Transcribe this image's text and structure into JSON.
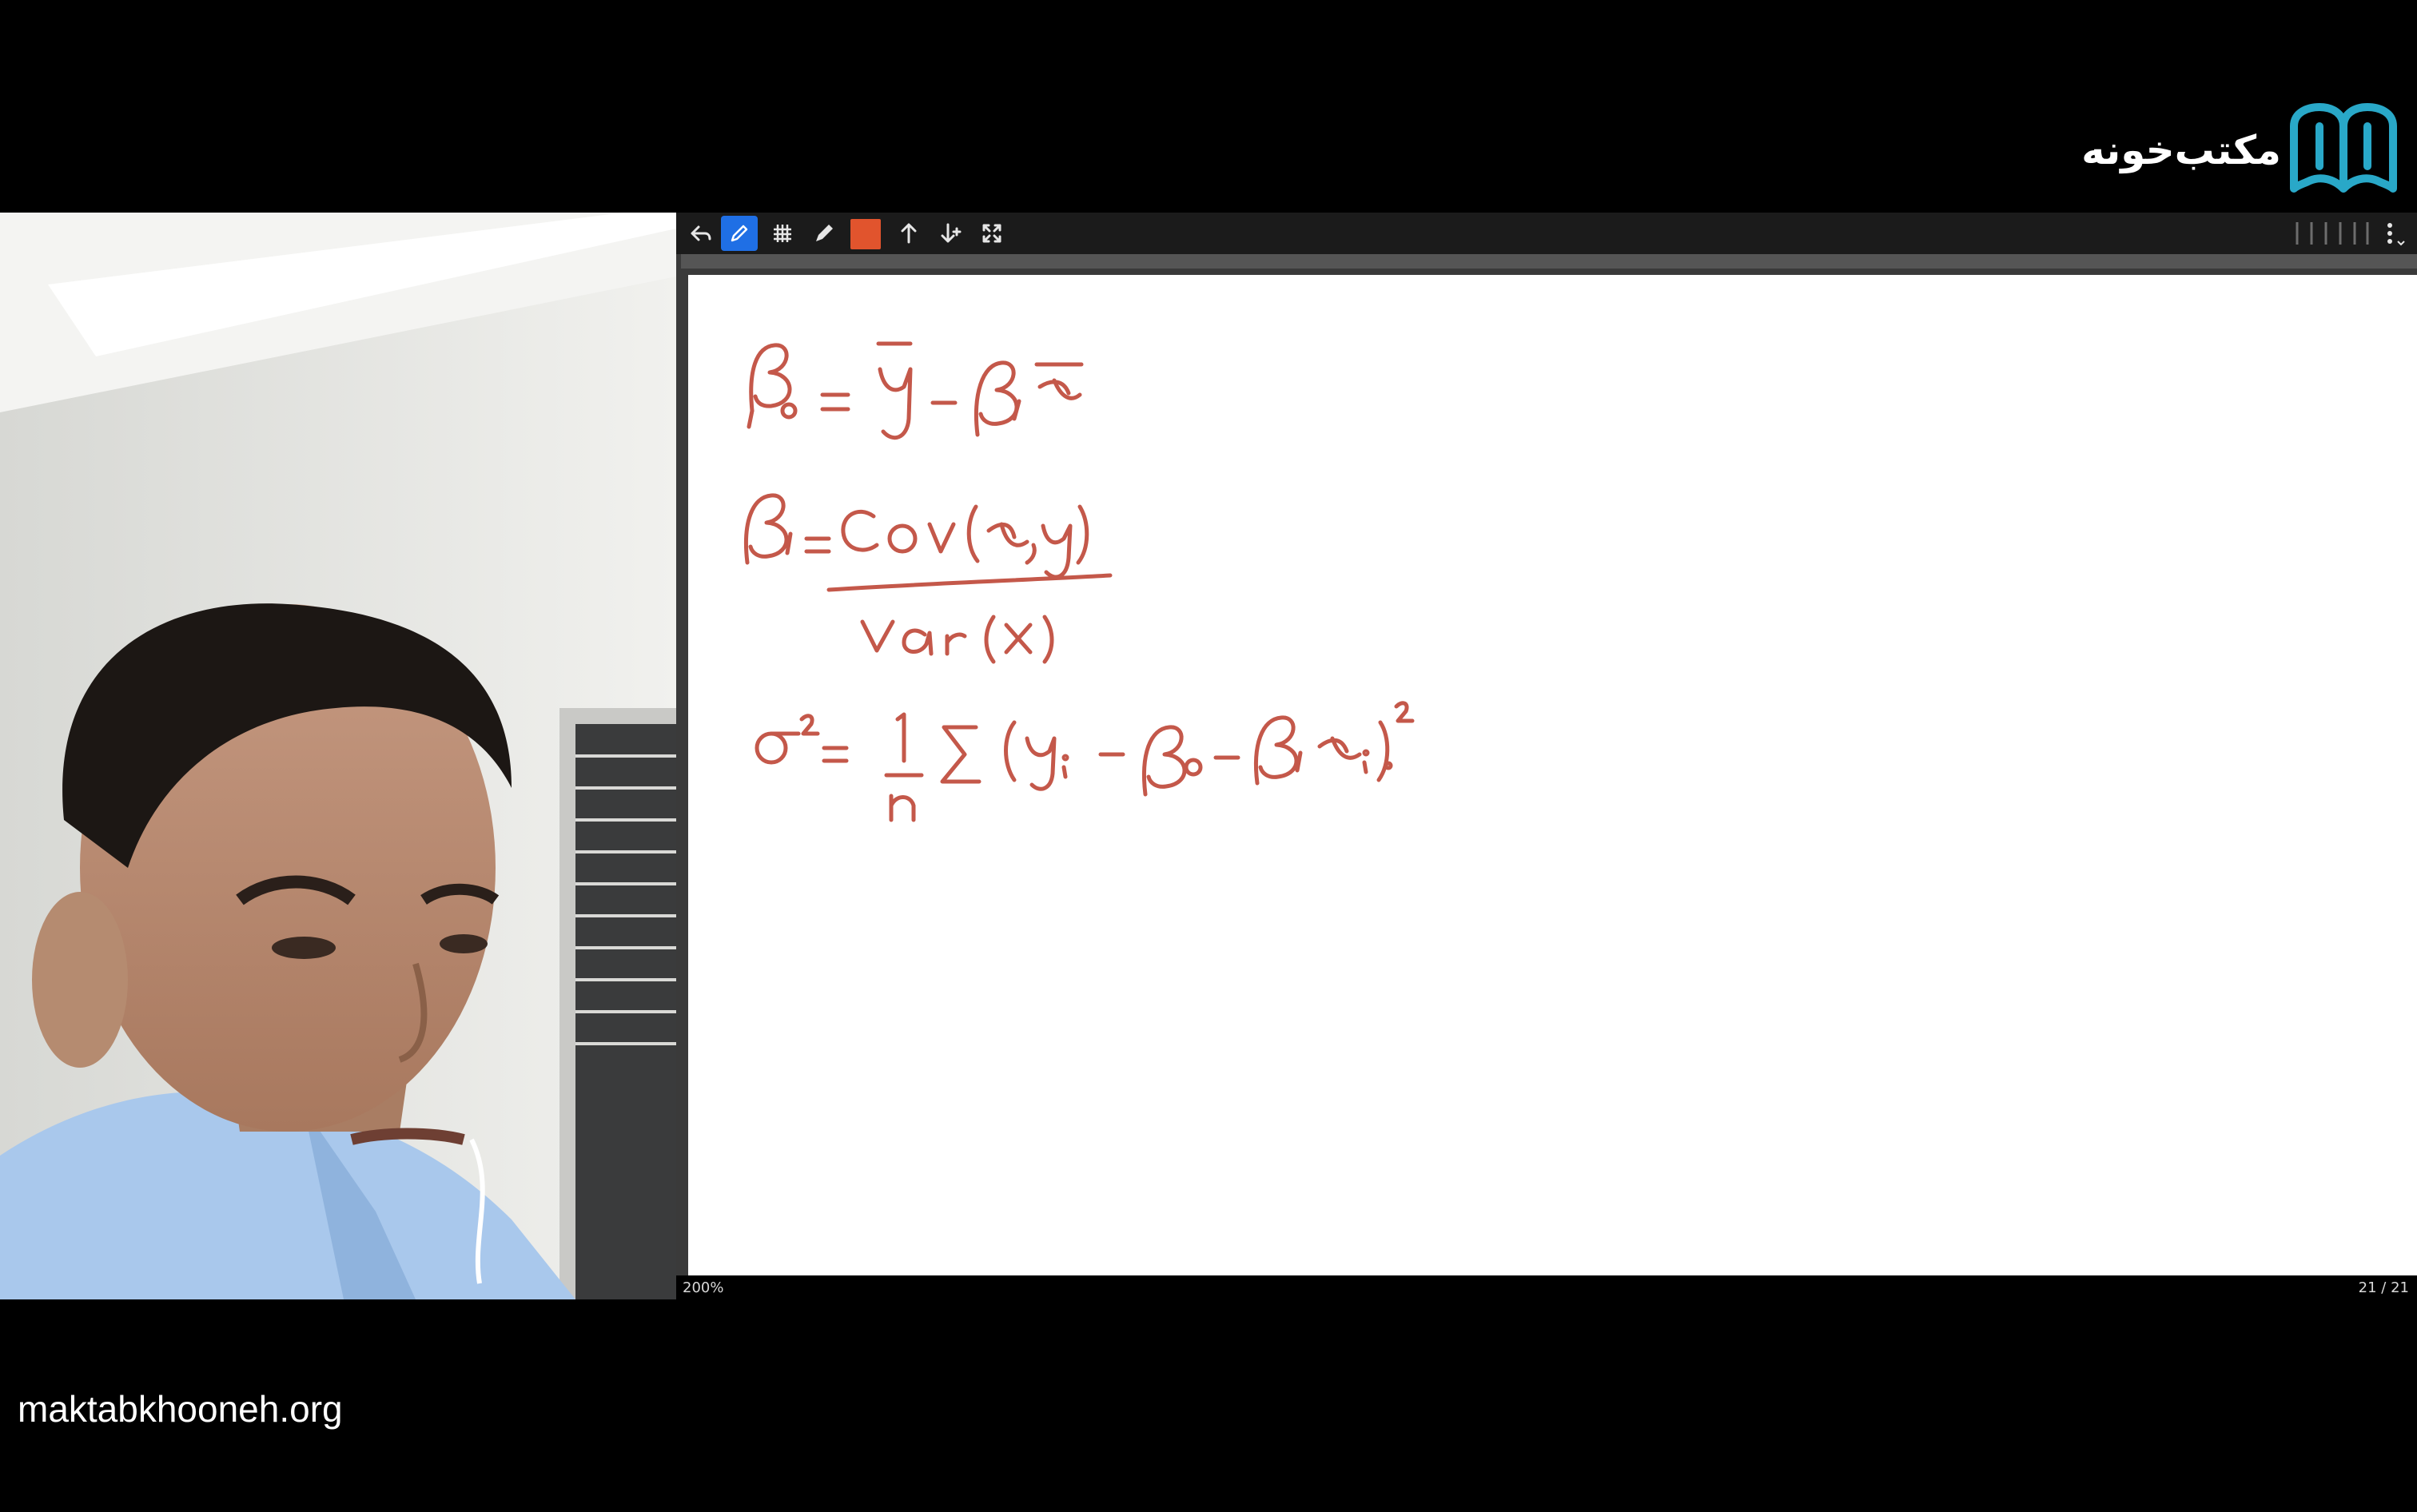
{
  "brand": {
    "name": "مکتب‌خونه",
    "icon": "open-book-logo-icon",
    "logo_color": "#29a8c8"
  },
  "webcam": {
    "description_icon": "presenter-video"
  },
  "toolbar": {
    "icons": [
      "undo-icon",
      "pen-icon",
      "grid-icon",
      "eraser-icon",
      "color-swatch",
      "arrow-up-icon",
      "arrow-down-icon",
      "fullscreen-icon",
      "page-strip-icon",
      "more-menu-icon"
    ],
    "pen_color": "#e1542d",
    "active_color": "#1f6fe5"
  },
  "whiteboard": {
    "ink_color": "#c4584a",
    "equations": [
      "β₀ = ȳ − β₁x̄",
      "β₁ = Cov(x, y) / Var(X)",
      "σ² = 1/n Σ (yᵢ − β₀ − β₁xᵢ)²"
    ]
  },
  "status": {
    "zoom": "200%",
    "page": "21 / 21"
  },
  "footer": {
    "url": "maktabkhooneh.org"
  }
}
